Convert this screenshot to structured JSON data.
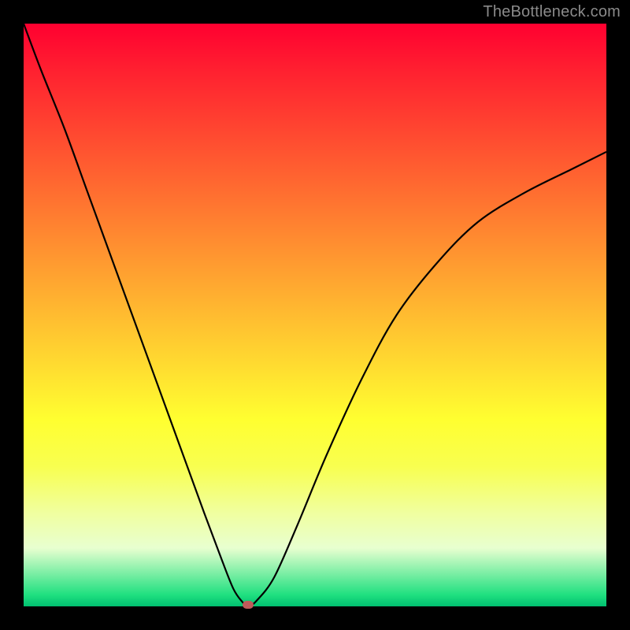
{
  "attribution": "TheBottleneck.com",
  "colors": {
    "frame": "#000000",
    "curve": "#000000",
    "marker": "#c05a5a",
    "gradient_top": "#ff0030",
    "gradient_bottom": "#00c070"
  },
  "chart_data": {
    "type": "line",
    "title": "",
    "xlabel": "",
    "ylabel": "",
    "xlim": [
      0,
      100
    ],
    "ylim": [
      0,
      100
    ],
    "grid": false,
    "series": [
      {
        "name": "bottleneck-curve",
        "x": [
          0,
          3,
          7,
          11,
          15,
          19,
          23,
          27,
          31,
          34,
          36,
          37.5,
          38.5,
          40,
          43,
          47,
          52,
          58,
          64,
          71,
          78,
          86,
          94,
          100
        ],
        "y": [
          100,
          92,
          82,
          71,
          60,
          49,
          38,
          27,
          16,
          8,
          3,
          0.8,
          0,
          1,
          5,
          14,
          26,
          39,
          50,
          59,
          66,
          71,
          75,
          78
        ]
      }
    ],
    "annotations": [
      {
        "name": "min-marker",
        "x": 38.5,
        "y": 0
      }
    ]
  }
}
